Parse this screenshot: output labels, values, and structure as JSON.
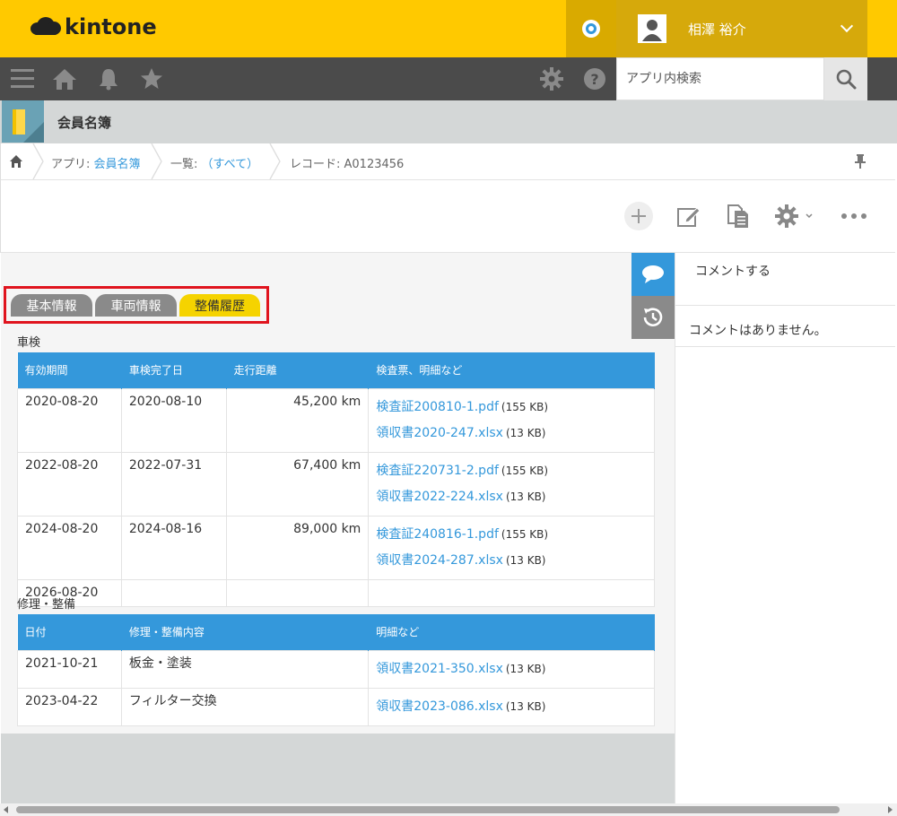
{
  "brand": {
    "name": "kintone",
    "color": "#ffc900"
  },
  "header": {
    "user_name": "相澤 裕介"
  },
  "navbar": {
    "icons": [
      "menu-icon",
      "home-icon",
      "bell-icon",
      "star-icon",
      "gear-icon",
      "help-icon"
    ],
    "search_placeholder": "アプリ内検索"
  },
  "app": {
    "title": "会員名簿"
  },
  "breadcrumb": {
    "app_prefix": "アプリ:",
    "app_link": "会員名簿",
    "list_prefix": "一覧:",
    "list_link": "（すべて）",
    "record": "レコード: A0123456"
  },
  "tabs": [
    {
      "label": "基本情報",
      "active": false
    },
    {
      "label": "車両情報",
      "active": false
    },
    {
      "label": "整備履歴",
      "active": true
    }
  ],
  "inspection": {
    "title": "車検",
    "columns": [
      "有効期間",
      "車検完了日",
      "走行距離",
      "検査票、明細など"
    ],
    "rows": [
      {
        "valid": "2020-08-20",
        "done": "2020-08-10",
        "distance": "45,200 km",
        "files": [
          {
            "name": "検査証200810-1.pdf",
            "size": "(155 KB)"
          },
          {
            "name": "領収書2020-247.xlsx",
            "size": "(13 KB)"
          }
        ]
      },
      {
        "valid": "2022-08-20",
        "done": "2022-07-31",
        "distance": "67,400 km",
        "files": [
          {
            "name": "検査証220731-2.pdf",
            "size": "(155 KB)"
          },
          {
            "name": "領収書2022-224.xlsx",
            "size": "(13 KB)"
          }
        ]
      },
      {
        "valid": "2024-08-20",
        "done": "2024-08-16",
        "distance": "89,000 km",
        "files": [
          {
            "name": "検査証240816-1.pdf",
            "size": "(155 KB)"
          },
          {
            "name": "領収書2024-287.xlsx",
            "size": "(13 KB)"
          }
        ]
      },
      {
        "valid": "2026-08-20",
        "done": "",
        "distance": "",
        "files": []
      }
    ]
  },
  "repair": {
    "title": "修理・整備",
    "columns": [
      "日付",
      "修理・整備内容",
      "明細など"
    ],
    "rows": [
      {
        "date": "2021-10-21",
        "content": "板金・塗装",
        "file": {
          "name": "領収書2021-350.xlsx",
          "size": "(13 KB)"
        }
      },
      {
        "date": "2023-04-22",
        "content": "フィルター交換",
        "file": {
          "name": "領収書2023-086.xlsx",
          "size": "(13 KB)"
        }
      }
    ]
  },
  "comments": {
    "input_label": "コメントする",
    "empty_text": "コメントはありません。"
  },
  "colors": {
    "accent": "#3498db",
    "active_tab": "#f5d300",
    "highlight_frame": "#e0141e",
    "navbar": "#4b4b4b"
  }
}
